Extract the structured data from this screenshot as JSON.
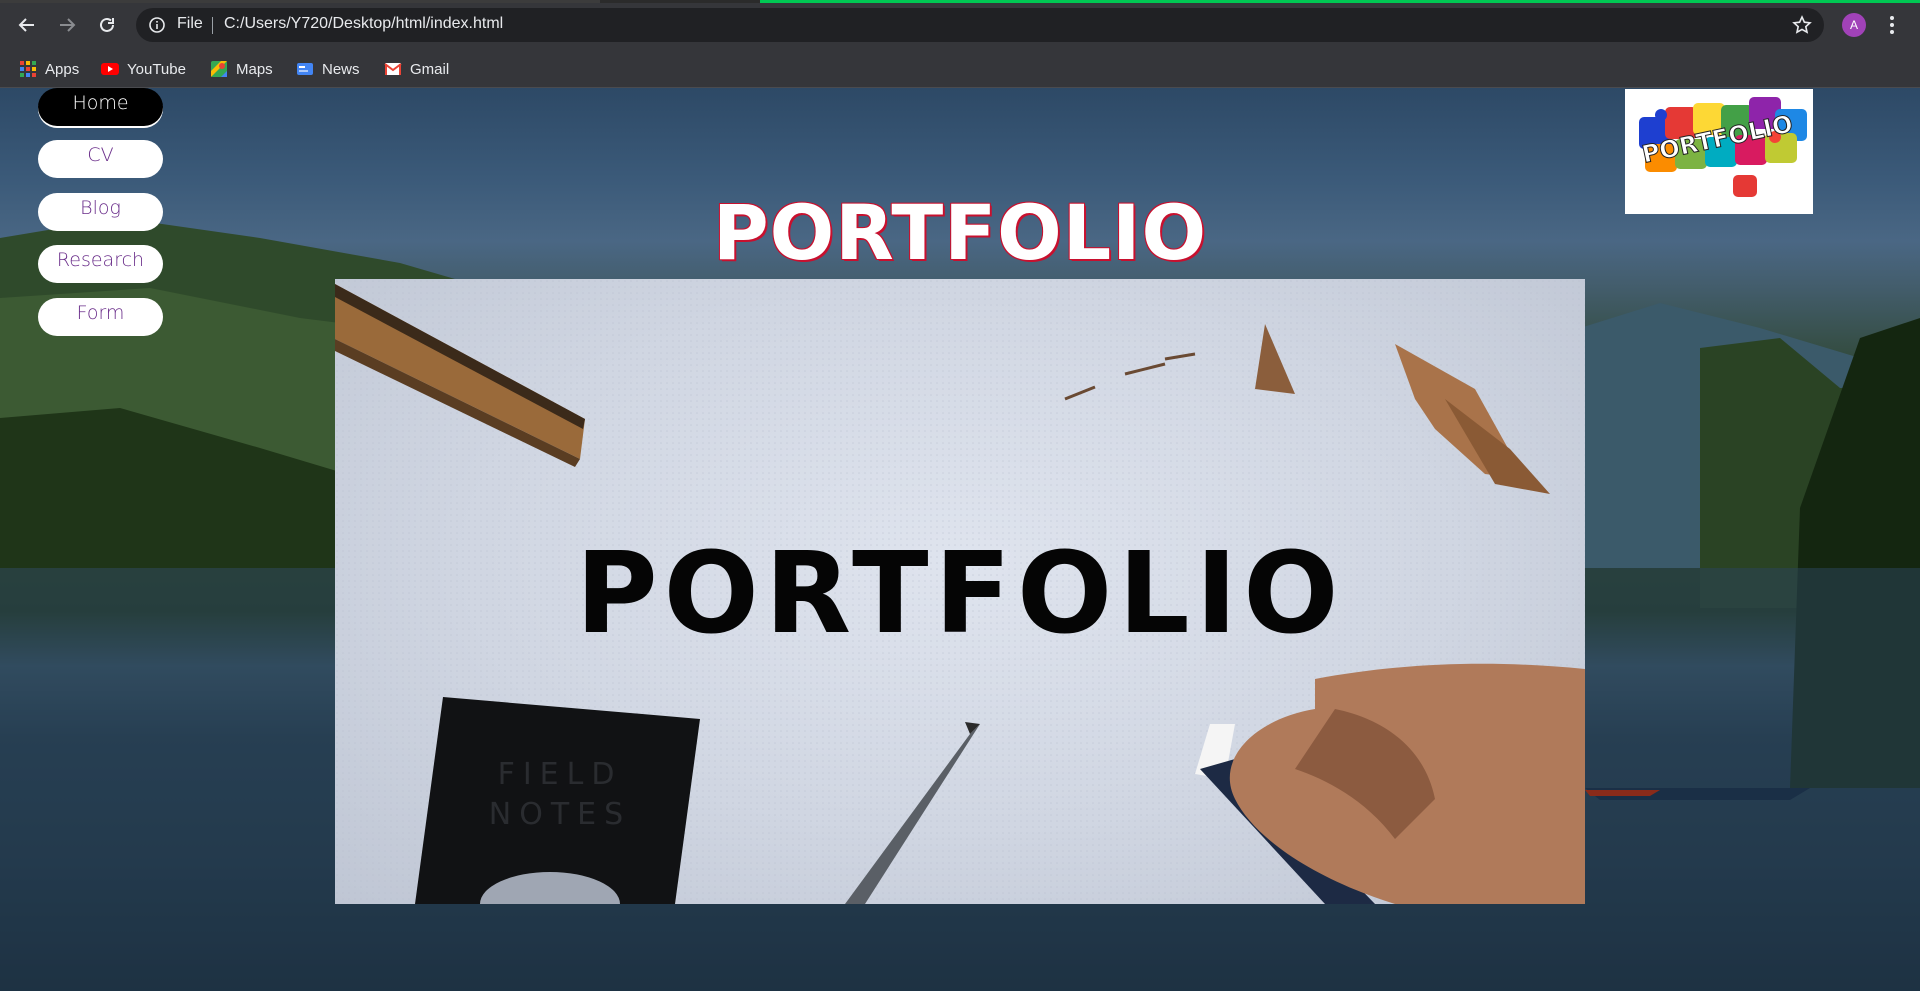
{
  "browser": {
    "scheme_label": "File",
    "url": "C:/Users/Y720/Desktop/html/index.html",
    "profile_initial": "A",
    "bookmarks": [
      {
        "label": "Apps",
        "icon": "apps-grid-icon"
      },
      {
        "label": "YouTube",
        "icon": "youtube-icon"
      },
      {
        "label": "Maps",
        "icon": "maps-icon"
      },
      {
        "label": "News",
        "icon": "news-icon"
      },
      {
        "label": "Gmail",
        "icon": "gmail-icon"
      }
    ],
    "colors": {
      "chrome": "#35363a",
      "omnibox": "#202124",
      "progress": "#00c853",
      "avatar": "#a142b8"
    }
  },
  "page": {
    "nav": [
      {
        "label": "Home",
        "active": true
      },
      {
        "label": "CV",
        "active": false
      },
      {
        "label": "Blog",
        "active": false
      },
      {
        "label": "Research",
        "active": false
      },
      {
        "label": "Form",
        "active": false
      }
    ],
    "heading": "PORTFOLIO",
    "logo_text": "PORTFOLIO",
    "hero_text": "PORTFOLIO",
    "hero_notebook_text": "FIELD NOTES",
    "colors": {
      "nav_text": "#6a2d8a",
      "heading_outline": "#c8102e",
      "active_nav": "#000000"
    }
  }
}
